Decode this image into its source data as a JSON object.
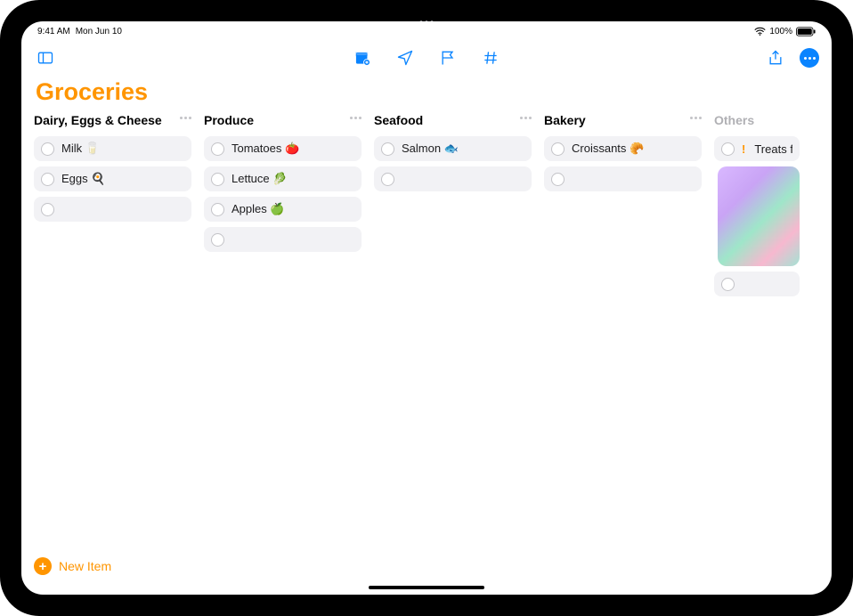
{
  "status": {
    "time": "9:41 AM",
    "date": "Mon Jun 10",
    "battery": "100%"
  },
  "list": {
    "title": "Groceries",
    "accent": "#ff9500"
  },
  "columns": [
    {
      "title": "Dairy, Eggs & Cheese",
      "items": [
        "Milk 🥛",
        "Eggs 🍳"
      ],
      "more": true
    },
    {
      "title": "Produce",
      "items": [
        "Tomatoes 🍅",
        "Lettuce 🥬",
        "Apples 🍏"
      ],
      "more": true
    },
    {
      "title": "Seafood",
      "items": [
        "Salmon 🐟"
      ],
      "more": true
    },
    {
      "title": "Bakery",
      "items": [
        "Croissants 🥐"
      ],
      "more": true
    },
    {
      "title": "Others",
      "dim": true,
      "cutoff": true,
      "items_special": [
        {
          "priority": "!",
          "text": "Treats for t"
        }
      ],
      "has_thumbnail": true
    }
  ],
  "footer": {
    "new_item": "New Item"
  }
}
